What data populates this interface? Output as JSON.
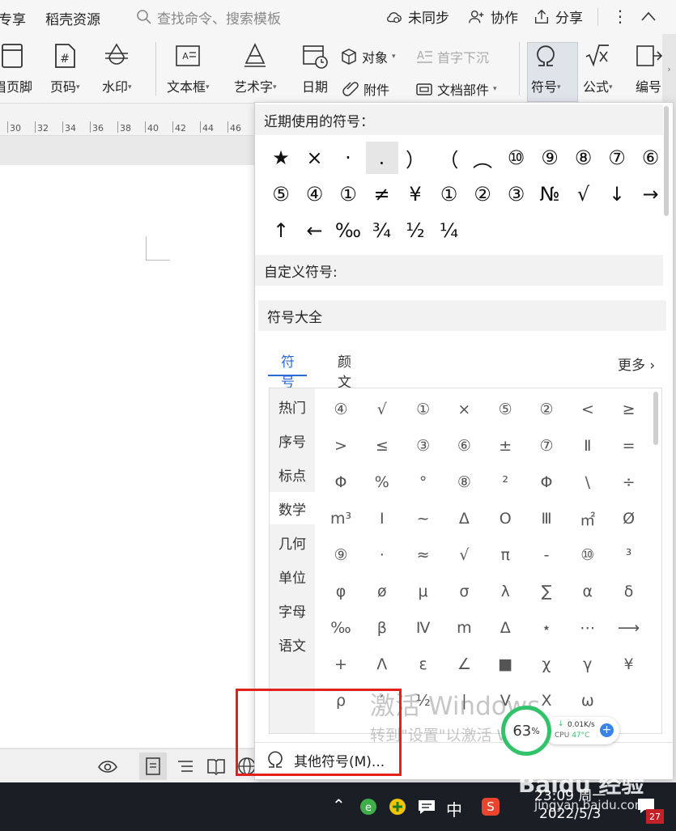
{
  "menubar": {
    "tab_share": "专享",
    "tab_resources": "稻壳资源",
    "search_placeholder": "查找命令、搜索模板",
    "sync_status": "未同步",
    "collaborate": "协作",
    "share": "分享"
  },
  "ribbon": {
    "header_footer": "眉页脚",
    "page_number": "页码",
    "watermark": "水印",
    "textbox": "文本框",
    "wordart": "艺术字",
    "date": "日期",
    "object": "对象",
    "attachment": "附件",
    "drop_cap": "首字下沉",
    "doc_parts": "文档部件",
    "symbol": "符号",
    "formula": "公式",
    "numbering": "编号"
  },
  "ruler": {
    "ticks": [
      "30",
      "32",
      "34",
      "36",
      "38",
      "40",
      "42",
      "44",
      "46"
    ]
  },
  "panel": {
    "recent_title": "近期使用的符号：",
    "recent_symbols": [
      "★",
      "×",
      "·",
      ".",
      "）",
      "（",
      "︵",
      "⑩",
      "⑨",
      "⑧",
      "⑦",
      "⑥",
      "⑤",
      "④",
      "①",
      "≠",
      "¥",
      "①",
      "②",
      "③",
      "№",
      "√",
      "↓",
      "→",
      "↑",
      "←",
      "‰",
      "¾",
      "½",
      "¼"
    ],
    "custom_title": "自定义符号:",
    "all_title": "符号大全",
    "tabs": [
      "符号",
      "颜文字"
    ],
    "more": "更多",
    "categories": [
      "热门",
      "序号",
      "标点",
      "数学",
      "几何",
      "单位",
      "字母",
      "语文"
    ],
    "active_category": "数学",
    "grid": [
      [
        "④",
        "√",
        "①",
        "×",
        "⑤",
        "②",
        "<",
        "≥"
      ],
      [
        ">",
        "≤",
        "③",
        "⑥",
        "±",
        "⑦",
        "Ⅱ",
        "="
      ],
      [
        "Φ",
        "%",
        "°",
        "⑧",
        "²",
        "Φ",
        "\\",
        "÷"
      ],
      [
        "m³",
        "Ⅰ",
        "~",
        "Δ",
        "O",
        "Ⅲ",
        "㎡",
        "Ø"
      ],
      [
        "⑨",
        "·",
        "≈",
        "√",
        "π",
        "-",
        "⑩",
        "³"
      ],
      [
        "φ",
        "ø",
        "μ",
        "σ",
        "λ",
        "∑",
        "α",
        "δ"
      ],
      [
        "‰",
        "β",
        "Ⅳ",
        "m",
        "Δ",
        "⋆",
        "⋯",
        "⟶"
      ],
      [
        "+",
        "Λ",
        "ε",
        "∠",
        "■",
        "χ",
        "γ",
        "¥"
      ],
      [
        "ρ",
        "′",
        "½",
        "|",
        "V",
        "X",
        "ω",
        ""
      ]
    ],
    "other_symbols": "其他符号(M)..."
  },
  "overlay": {
    "activate_line1": "激活 Windows",
    "activate_line2": "转到\"设置\"以激活 Windows。",
    "gauge_value": "63",
    "gauge_unit": "%",
    "net_speed": "0.01K/s",
    "cpu_label": "CPU",
    "cpu_temp": "47°C",
    "baidu_logo": "Baidu 经验",
    "baidu_url": "jingyan.baidu.com"
  },
  "taskbar": {
    "time": "23:09 周一",
    "date": "2022/5/3",
    "ime": "中",
    "notif_count": "27"
  }
}
